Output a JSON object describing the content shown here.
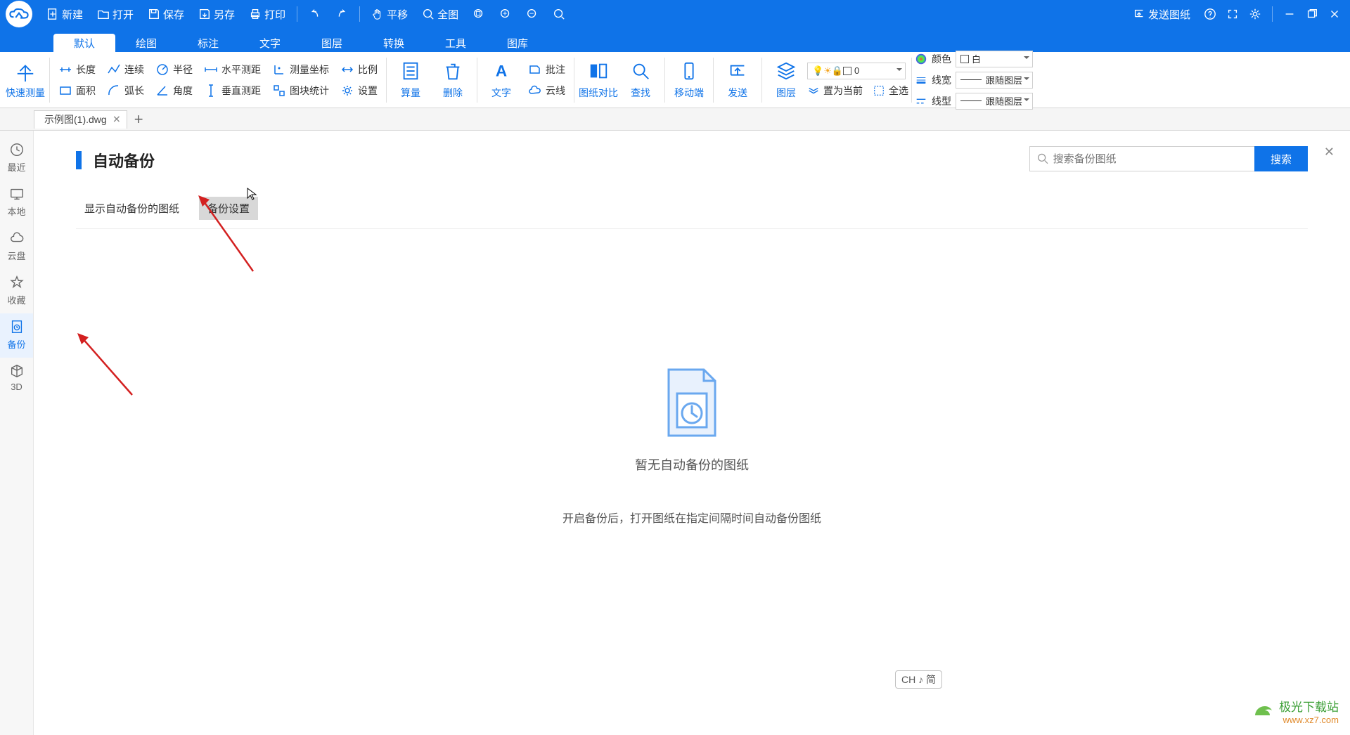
{
  "titlebar": {
    "new": "新建",
    "open": "打开",
    "save": "保存",
    "saveas": "另存",
    "print": "打印",
    "pan": "平移",
    "fit": "全图",
    "send": "发送图纸"
  },
  "menutabs": [
    "默认",
    "绘图",
    "标注",
    "文字",
    "图层",
    "转换",
    "工具",
    "图库"
  ],
  "ribbon": {
    "quick": "快速测量",
    "length": "长度",
    "continuous": "连续",
    "radius": "半径",
    "hdist": "水平测距",
    "coord": "测量坐标",
    "scale": "比例",
    "area": "面积",
    "arc": "弧长",
    "angle": "角度",
    "vdist": "垂直测距",
    "blockstat": "图块统计",
    "settings": "设置",
    "calc": "算量",
    "delete": "删除",
    "text": "文字",
    "annotate": "批注",
    "cloud": "云线",
    "compare": "图纸对比",
    "find": "查找",
    "mobile": "移动端",
    "send": "发送",
    "layer": "图层",
    "setcurrent": "置为当前",
    "selectall": "全选",
    "color_lbl": "颜色",
    "color_val": "白",
    "lw_lbl": "线宽",
    "lw_val": "跟随图层",
    "lt_lbl": "线型",
    "lt_val": "跟随图层",
    "layer_val": "0"
  },
  "filetab": "示例图(1).dwg",
  "sidebar": [
    "最近",
    "本地",
    "云盘",
    "收藏",
    "备份",
    "3D"
  ],
  "page": {
    "title": "自动备份",
    "tab1": "显示自动备份的图纸",
    "tab2": "备份设置",
    "search_ph": "搜索备份图纸",
    "search_btn": "搜索",
    "empty1": "暂无自动备份的图纸",
    "empty2": "开启备份后，打开图纸在指定间隔时间自动备份图纸"
  },
  "ime": "CH ♪ 简",
  "watermark": {
    "name": "极光下载站",
    "url": "www.xz7.com"
  }
}
